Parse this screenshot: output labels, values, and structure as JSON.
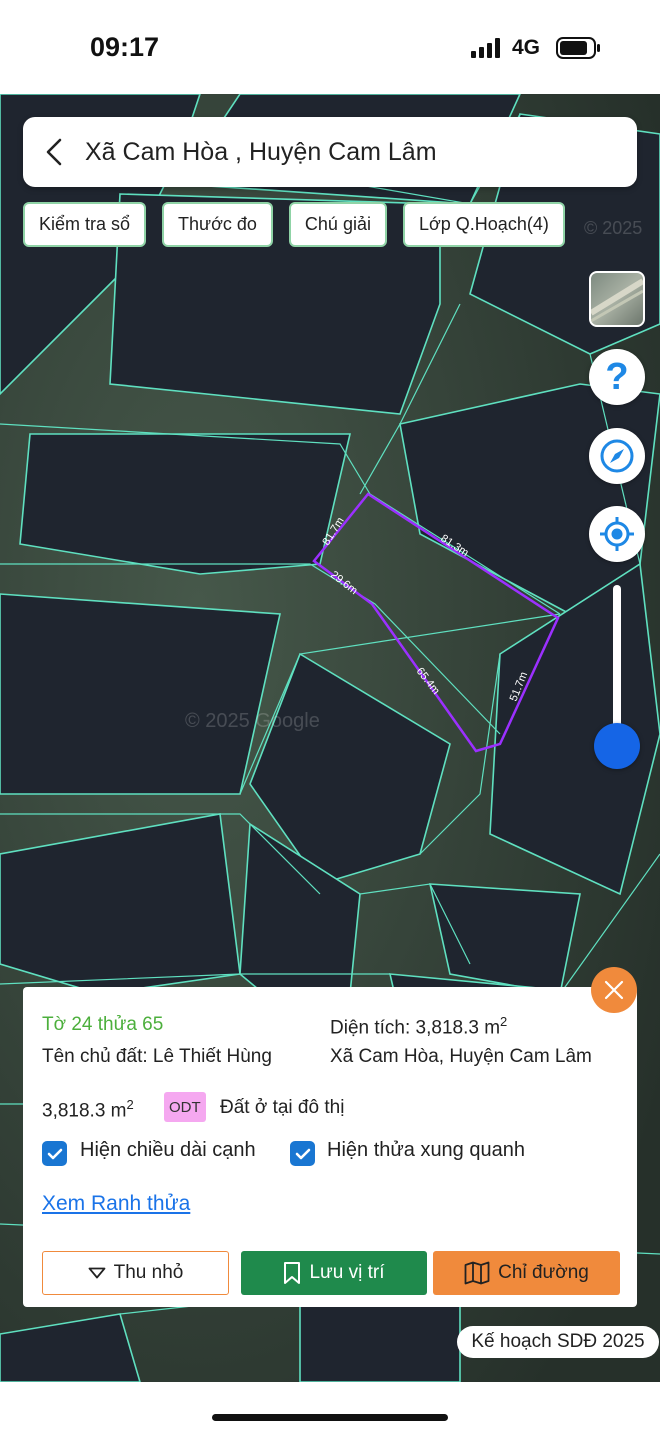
{
  "status_bar": {
    "time": "09:17",
    "network": "4G"
  },
  "header": {
    "title": "Xã Cam Hòa , Huyện Cam Lâm"
  },
  "chips": [
    {
      "label": "Kiểm tra sổ"
    },
    {
      "label": "Thước đo"
    },
    {
      "label": "Chú giải"
    },
    {
      "label": "Lớp Q.Hoạch(4)"
    }
  ],
  "map": {
    "watermark_top": "© 2025",
    "watermark_mid": "© 2025 Google",
    "edge_labels": [
      "81.7m",
      "81.3m",
      "29.6m",
      "65.4m",
      "51.7m"
    ],
    "plan_badge": "Kế hoạch SDĐ 2025"
  },
  "info": {
    "parcel_id": "Tờ 24 thửa 65",
    "area_label": "Diện tích: 3,818.3 m",
    "area_sup": "2",
    "owner": "Tên chủ đất: Lê Thiết Hùng",
    "address": "Xã Cam Hòa, Huyện Cam Lâm",
    "land_area": "3,818.3 m",
    "land_area_sup": "2",
    "land_code": "ODT",
    "land_type": "Đất ở tại đô thị",
    "checkbox_edges": "Hiện chiều dài cạnh",
    "checkbox_neighbors": "Hiện thửa xung quanh",
    "boundary_link": "Xem Ranh thửa",
    "btn_minimize": "Thu nhỏ",
    "btn_save": "Lưu vị trí",
    "btn_directions": "Chỉ đường"
  },
  "colors": {
    "accent_orange": "#f08a3c",
    "accent_green": "#1f8a4c",
    "parcel_green_text": "#4caf3c",
    "parcel_outline": "#9b30ff",
    "parcel_lines": "#5fe0c0",
    "link_blue": "#1a73e8",
    "slider_blue": "#1565e6"
  }
}
